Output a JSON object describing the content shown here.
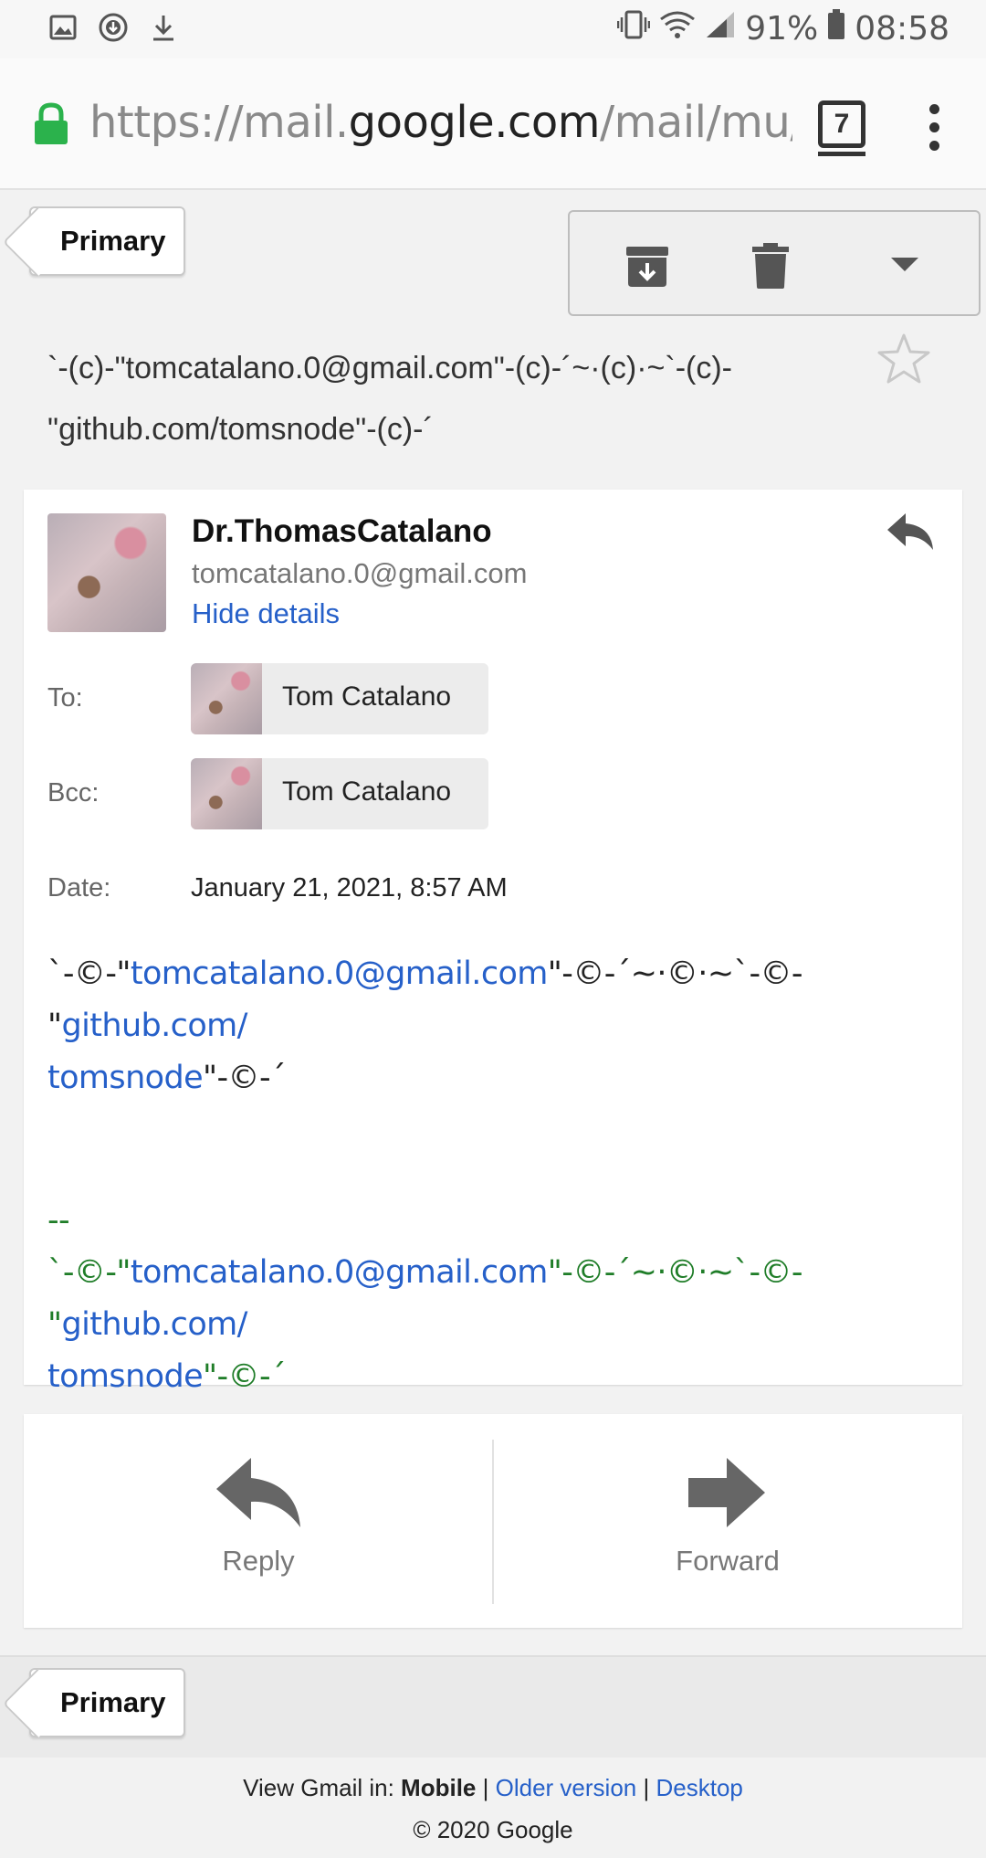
{
  "status_bar": {
    "battery": "91%",
    "time": "08:58"
  },
  "browser": {
    "url_prefix": "https://mail.",
    "url_domain": "google.com",
    "url_path": "/mail/mu/mp/",
    "tab_count": "7"
  },
  "nav": {
    "primary_label": "Primary"
  },
  "subject": {
    "text": "`-(c)-\"tomcatalano.0@gmail.com\"-(c)-´~·(c)·~`-(c)-\"github.com/tomsnode\"-(c)-´"
  },
  "message": {
    "sender_name": "Dr.ThomasCatalano",
    "sender_email": "tomcatalano.0@gmail.com",
    "hide_details": "Hide details",
    "to_label": "To:",
    "to_name": "Tom Catalano",
    "bcc_label": "Bcc:",
    "bcc_name": "Tom Catalano",
    "date_label": "Date:",
    "date_value": "January 21, 2021, 8:57 AM",
    "body": {
      "p1": "`-©-\"",
      "link_email": "tomcatalano.0@gmail.com",
      "p2": "\"-©-´~·©·~`-©-\"",
      "link_github_a": "github.com/",
      "link_github_b": "tomsnode",
      "p3": "\"-©-´"
    },
    "signature": {
      "dashes": "--",
      "p1": "`-©-\"",
      "link_email": "tomcatalano.0@gmail.com",
      "p2": "\"-©-´~·©·~`-©-\"",
      "link_github_a": "github.com/",
      "link_github_b": "tomsnode",
      "p3": "\"-©-´"
    }
  },
  "actions": {
    "reply": "Reply",
    "forward": "Forward"
  },
  "footer": {
    "view_in": "View Gmail in:",
    "mobile": "Mobile",
    "sep": "|",
    "older": "Older version",
    "desktop": "Desktop",
    "copyright": "© 2020 Google"
  },
  "colors": {
    "link": "#2660c9",
    "signature": "#1f7d28",
    "lock": "#2bb24c"
  }
}
